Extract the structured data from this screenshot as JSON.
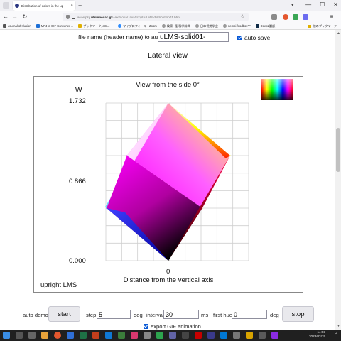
{
  "browser": {
    "tab_title": "Distribution of colors in the up",
    "tab_close": "×",
    "new_tab": "+",
    "url_host_prefix": "www.psy.",
    "url_host_strong": "ritsumei.ac.jp",
    "url_path": "/~akitaoka/JavaScript-uLMS-distribution01.html",
    "window_min": "—",
    "window_max": "☐",
    "window_close": "✕"
  },
  "bookmarks": {
    "items": [
      {
        "label": "Journal of Illusion",
        "icon": "journal-icon",
        "color": "#555555"
      },
      {
        "label": "MP4 to GIF Converter ...",
        "icon": "converter-icon",
        "color": "#1d6fd6"
      },
      {
        "label": "ブックマークメニュー",
        "icon": "folder-icon",
        "color": "#e0b000"
      },
      {
        "label": "マイプロフィール · Zoom",
        "icon": "zoom-icon",
        "color": "#2d8cff"
      },
      {
        "label": "検索 - 脳科学辞典",
        "icon": "globe-icon",
        "color": "#888888"
      },
      {
        "label": "日本視覚学会",
        "icon": "globe-icon",
        "color": "#888888"
      },
      {
        "label": "nempi foodbox™",
        "icon": "globe-icon",
        "color": "#888888"
      },
      {
        "label": "DeepL翻訳",
        "icon": "deepl-icon",
        "color": "#0f2b46"
      }
    ],
    "other": "他のブックマーク"
  },
  "page": {
    "file_name_label": "file name (header name) to auto-save",
    "file_name_value": "uLMS-solid01-",
    "auto_save_label": "auto save",
    "section_title": "Lateral view",
    "plot_title": "View from the side 0°",
    "y_axis_letter": "W",
    "corner_label": "upright LMS"
  },
  "controls": {
    "auto_demo_label": "auto demo:",
    "start_label": "start",
    "step_label": "step",
    "step_value": "5",
    "step_unit": "deg",
    "interval_label": "interval",
    "interval_value": "30",
    "interval_unit": "ms",
    "first_hue_label": "first hue",
    "first_hue_value": "0",
    "first_hue_unit": "deg",
    "stop_label": "stop",
    "export_label": "export GIF animation"
  },
  "chart_data": {
    "type": "scatter",
    "title": "View from the side 0°",
    "xlabel": "Distance from the vertical axis",
    "ylabel": "W",
    "y_ticks": [
      "1.732",
      "0.866",
      "0.000"
    ],
    "x_ticks": [
      "0"
    ],
    "ylim": [
      0,
      1.732
    ],
    "grid": true,
    "solid_corners": [
      {
        "name": "black",
        "x": 0,
        "y": 0,
        "color": "#000000"
      },
      {
        "name": "blue",
        "x": -0.82,
        "y": 0.577,
        "color": "#0000ff"
      },
      {
        "name": "magenta",
        "x": -0.55,
        "y": 1.155,
        "color": "#ff00ff"
      },
      {
        "name": "white",
        "x": 0,
        "y": 1.732,
        "color": "#ffffff"
      },
      {
        "name": "yellow",
        "x": 0.82,
        "y": 1.155,
        "color": "#ffff00"
      },
      {
        "name": "red",
        "x": 0.45,
        "y": 0.577,
        "color": "#ff0000"
      }
    ]
  },
  "taskbar": {
    "time": "14:03",
    "date": "2023/03/15",
    "tray": "⌃"
  }
}
